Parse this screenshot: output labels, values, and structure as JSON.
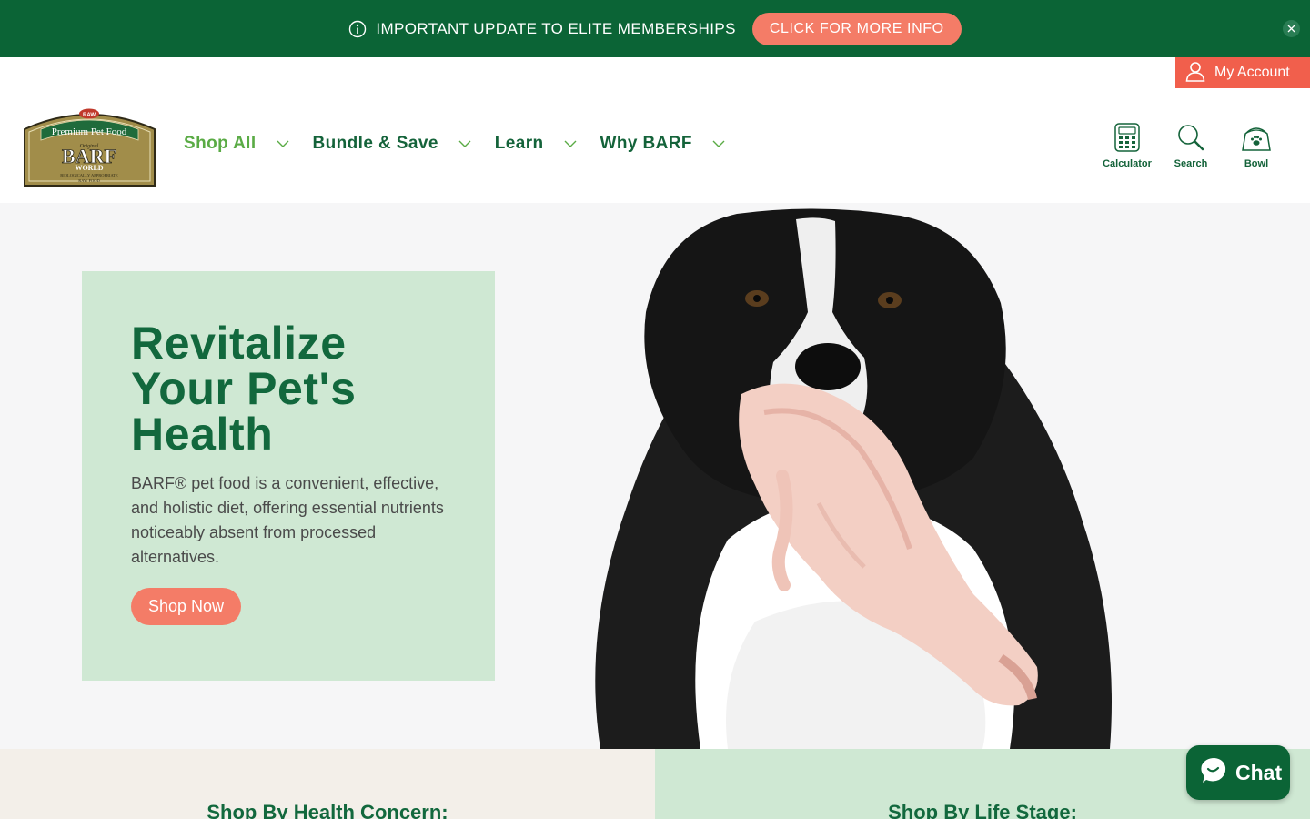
{
  "announcement": {
    "icon": "info-icon",
    "text": "IMPORTANT UPDATE TO ELITE MEMBERSHIPS",
    "button_label": "CLICK FOR MORE INFO",
    "close_icon": "close-icon"
  },
  "header": {
    "account_label": "My Account",
    "logo": {
      "top_badge": "RAW",
      "line1": "Premium Pet Food",
      "line2": "Original",
      "brand": "BARF",
      "world": "WORLD",
      "tagline1": "BIOLOGICALLY APPROPRIATE",
      "tagline2": "RAW FOOD"
    },
    "nav": [
      {
        "label": "Shop All",
        "active": true
      },
      {
        "label": "Bundle & Save",
        "active": false
      },
      {
        "label": "Learn",
        "active": false
      },
      {
        "label": "Why BARF",
        "active": false
      }
    ],
    "tools": [
      {
        "label": "Calculator",
        "icon": "calculator-icon"
      },
      {
        "label": "Search",
        "icon": "search-icon"
      },
      {
        "label": "Bowl",
        "icon": "bowl-icon"
      }
    ]
  },
  "hero": {
    "title_lines": [
      "Revitalize",
      "Your Pet's",
      "Health"
    ],
    "text": "BARF® pet food is a convenient, effective, and holistic diet, offering essential nutrients noticeably absent from processed alternatives.",
    "button_label": "Shop Now"
  },
  "sections": {
    "left_title": "Shop By Health Concern:",
    "right_title": "Shop By Life Stage:"
  },
  "chat": {
    "label": "Chat",
    "icon": "chat-bubble-icon"
  },
  "colors": {
    "brand_green": "#0b6436",
    "accent_coral": "#f47c67",
    "account_red": "#f15f4c",
    "hero_card": "#cfe8d3",
    "nav_active": "#5aab45"
  }
}
